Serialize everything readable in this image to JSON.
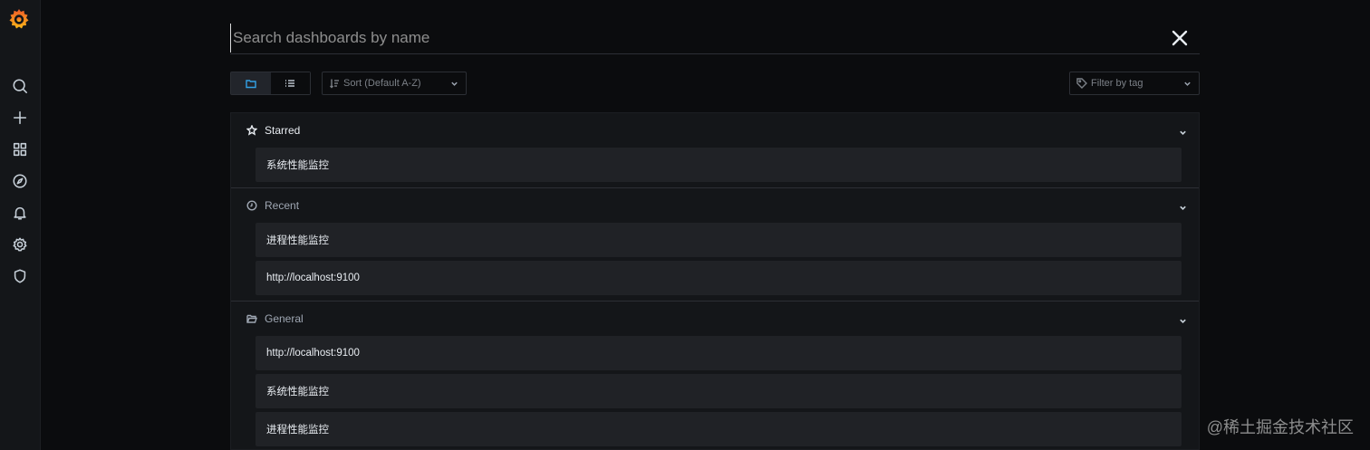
{
  "search": {
    "placeholder": "Search dashboards by name",
    "value": ""
  },
  "toolbar": {
    "view_modes": [
      "folder-view",
      "list-view"
    ],
    "active_view": "folder-view",
    "sort_label": "Sort (Default A-Z)",
    "tag_filter_label": "Filter by tag"
  },
  "sections": {
    "starred": {
      "title": "Starred",
      "icon": "star-icon",
      "items": [
        "系统性能监控"
      ]
    },
    "recent": {
      "title": "Recent",
      "icon": "clock-icon",
      "items": [
        "进程性能监控",
        "http://localhost:9100"
      ]
    },
    "general": {
      "title": "General",
      "icon": "folder-open-icon",
      "items": [
        "http://localhost:9100",
        "系统性能监控",
        "进程性能监控"
      ]
    }
  },
  "sidebar": {
    "items": [
      "search-icon",
      "plus-icon",
      "dashboards-icon",
      "explore-icon",
      "alerting-icon",
      "configuration-icon",
      "shield-icon"
    ]
  },
  "watermark": "@稀土掘金技术社区",
  "colors": {
    "background": "#0b0c0e",
    "panel": "#141619",
    "item": "#202226",
    "accent": "#33a2e5",
    "logo": "#f05a28"
  }
}
